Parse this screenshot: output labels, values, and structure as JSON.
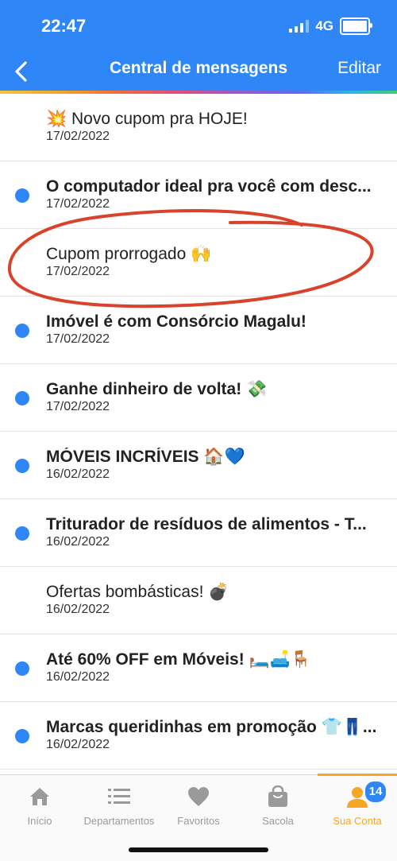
{
  "status_bar": {
    "time": "22:47",
    "network": "4G"
  },
  "header": {
    "title": "Central de mensagens",
    "edit_label": "Editar"
  },
  "colors": {
    "brand_blue": "#2f86f6",
    "accent_orange": "#f5a623",
    "annotation_red": "#d9432c"
  },
  "messages": [
    {
      "title": "💥 Novo cupom pra HOJE!",
      "date": "17/02/2022",
      "unread": false
    },
    {
      "title": "O computador ideal pra você com desc...",
      "date": "17/02/2022",
      "unread": true
    },
    {
      "title": "Cupom prorrogado 🙌",
      "date": "17/02/2022",
      "unread": false
    },
    {
      "title": "Imóvel é com Consórcio Magalu!",
      "date": "17/02/2022",
      "unread": true
    },
    {
      "title": "Ganhe dinheiro de volta! 💸",
      "date": "17/02/2022",
      "unread": true
    },
    {
      "title": "MÓVEIS INCRÍVEIS 🏠💙",
      "date": "16/02/2022",
      "unread": true
    },
    {
      "title": "Triturador de resíduos de alimentos - T...",
      "date": "16/02/2022",
      "unread": true
    },
    {
      "title": "Ofertas bombásticas! 💣",
      "date": "16/02/2022",
      "unread": false
    },
    {
      "title": "Até 60% OFF em Móveis! 🛏️🛋️🪑",
      "date": "16/02/2022",
      "unread": true
    },
    {
      "title": "Marcas queridinhas em promoção 👕👖...",
      "date": "16/02/2022",
      "unread": true
    }
  ],
  "tabbar": {
    "tabs": [
      {
        "label": "Início",
        "icon": "home-icon"
      },
      {
        "label": "Departamentos",
        "icon": "list-icon"
      },
      {
        "label": "Favoritos",
        "icon": "heart-icon"
      },
      {
        "label": "Sacola",
        "icon": "bag-icon"
      },
      {
        "label": "Sua Conta",
        "icon": "user-icon"
      }
    ],
    "active_tab": "Sua Conta",
    "badge_count": "14"
  }
}
